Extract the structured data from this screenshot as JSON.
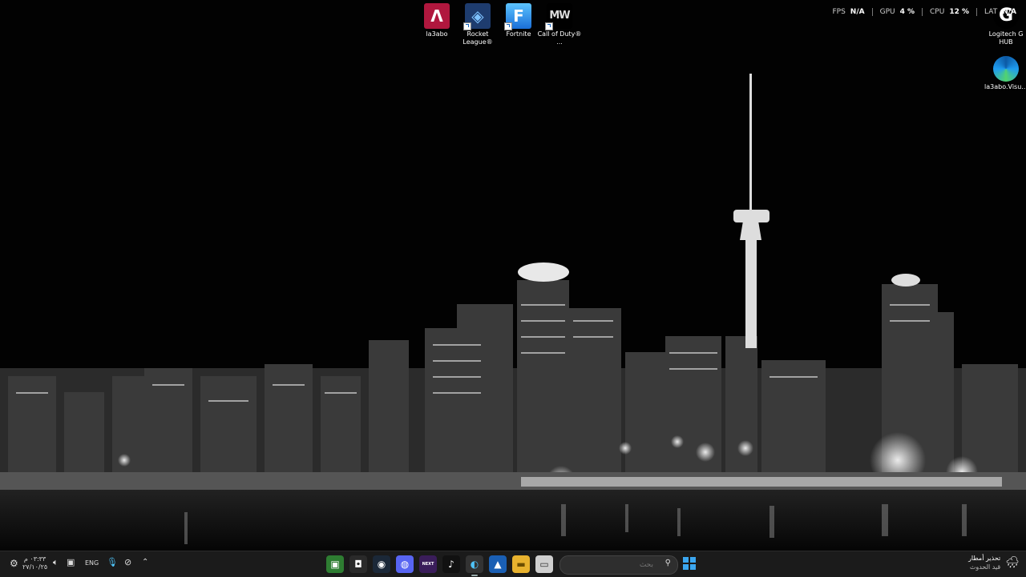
{
  "desktop_icons": [
    {
      "label": "la3abo",
      "color": "#b0173e",
      "glyph": "Λ",
      "icon": "la3abo-app-icon"
    },
    {
      "label": "Rocket League®",
      "color": "#1e3c6e",
      "glyph": "◈",
      "icon": "rocket-league-icon"
    },
    {
      "label": "Fortnite",
      "color": "#2196f3",
      "glyph": "F",
      "icon": "fortnite-icon"
    },
    {
      "label": "Call of Duty® ...",
      "color": "#000000",
      "glyph": "MW",
      "icon": "call-of-duty-icon"
    }
  ],
  "right_icons": [
    {
      "label": "Logitech G HUB",
      "icon": "logitech-g-hub-icon"
    },
    {
      "label": "la3abo.Visu...",
      "icon": "edge-icon"
    }
  ],
  "perf": {
    "fps_label": "FPS",
    "fps_value": "N/A",
    "gpu_label": "GPU",
    "gpu_value": "4 %",
    "cpu_label": "CPU",
    "cpu_value": "12 %",
    "lat_label": "LAT",
    "lat_value": "N/A"
  },
  "taskbar": {
    "apps": [
      {
        "name": "xbox-game-bar",
        "color": "#2e7d32",
        "glyph": "▣"
      },
      {
        "name": "epic-games",
        "color": "#2a2a2a",
        "glyph": "◘"
      },
      {
        "name": "steam",
        "color": "#1b2838",
        "glyph": "◉"
      },
      {
        "name": "discord",
        "color": "#5865f2",
        "glyph": "◍"
      },
      {
        "name": "kick",
        "color": "#3a1d5a",
        "glyph": "NEXT"
      },
      {
        "name": "tiktok",
        "color": "#111111",
        "glyph": "♪"
      },
      {
        "name": "edge",
        "color": "#0b7fae",
        "glyph": "◐"
      },
      {
        "name": "photos",
        "color": "#1a5fb4",
        "glyph": "▲"
      },
      {
        "name": "file-explorer",
        "color": "#e8b22e",
        "glyph": "▬"
      },
      {
        "name": "terminal",
        "color": "#cfcfcf",
        "glyph": "▭"
      }
    ],
    "search_placeholder": "بحث",
    "windows_start": "start",
    "lang": "ENG",
    "time": "٠٣:٣٣ م",
    "date": "٢٧/١٠/٢٥",
    "weather_title": "تحذير أمطار",
    "weather_sub": "قيد الحدوث"
  }
}
